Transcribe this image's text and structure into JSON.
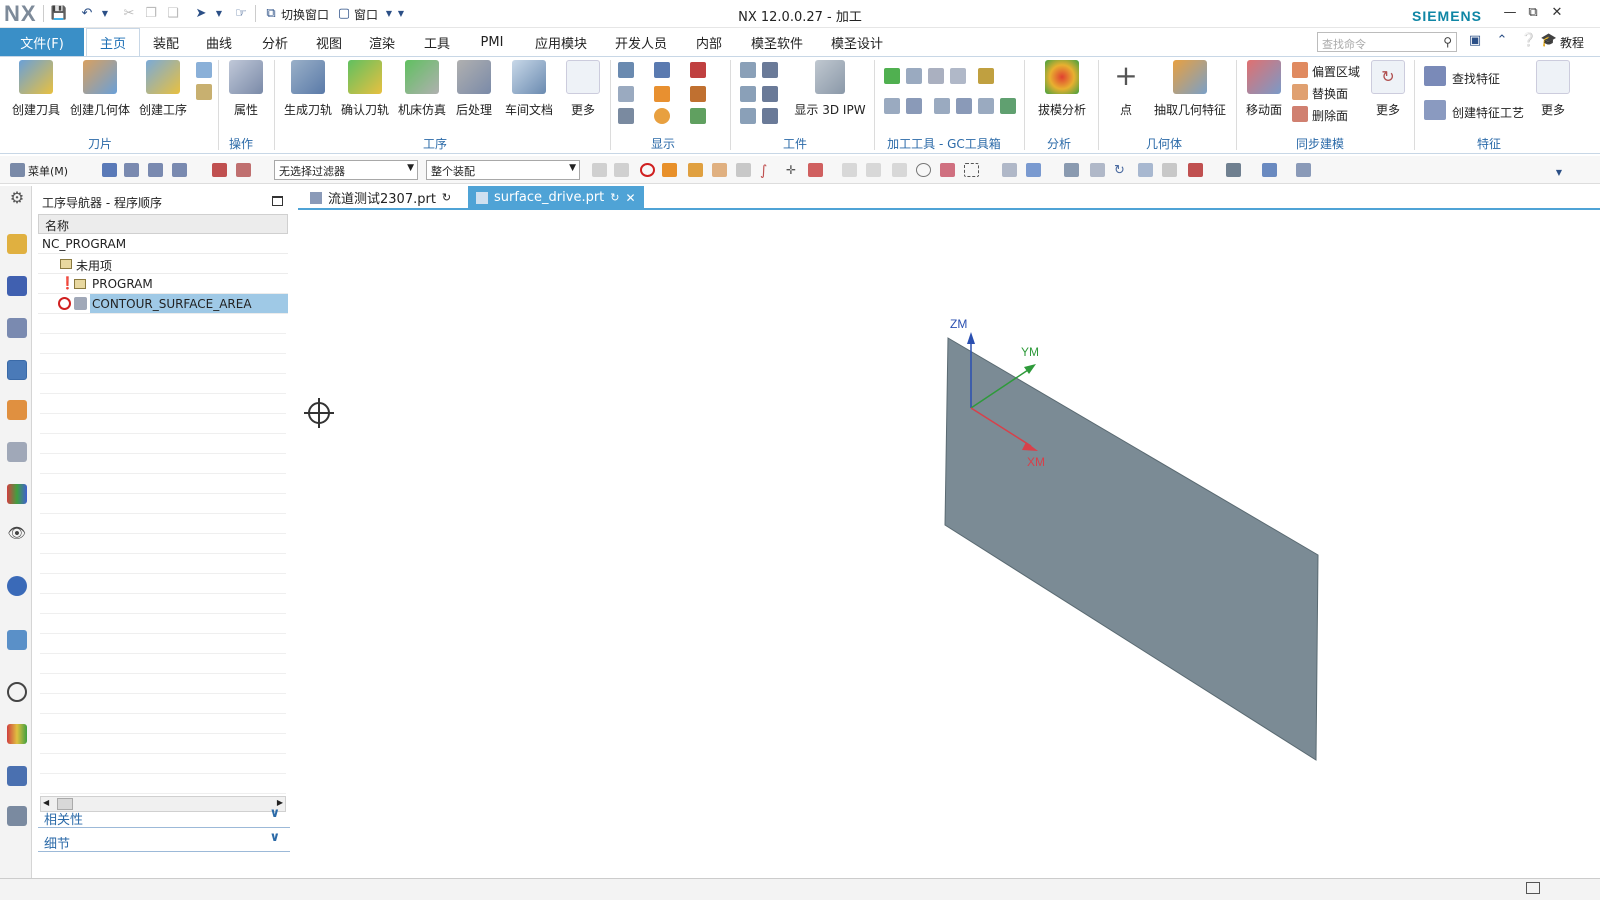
{
  "app": {
    "logo": "NX",
    "window_title": "NX 12.0.0.27 - 加工",
    "brand": "SIEMENS",
    "brand_color": "#0f86a5"
  },
  "quick_access": {
    "switch_window": "切换窗口",
    "window": "窗口"
  },
  "menu": {
    "file": "文件(F)",
    "tabs": [
      "主页",
      "装配",
      "曲线",
      "分析",
      "视图",
      "渲染",
      "工具",
      "PMI",
      "应用模块",
      "开发人员",
      "内部",
      "模圣软件",
      "模圣设计"
    ],
    "active_tab": "主页",
    "search_placeholder": "查找命令",
    "tutorial": "教程"
  },
  "ribbon": {
    "buttons": {
      "create_tool": "创建刀具",
      "create_geometry": "创建几何体",
      "create_operation": "创建工序",
      "properties": "属性",
      "generate_path": "生成刀轨",
      "verify_path": "确认刀轨",
      "machine_sim": "机床仿真",
      "post_process": "后处理",
      "shop_doc": "车间文档",
      "more1": "更多",
      "show_3d_ipw": "显示 3D IPW",
      "draft_analysis": "拔模分析",
      "point": "点",
      "extract_geometry": "抽取几何特征",
      "move_face": "移动面",
      "offset_region": "偏置区域",
      "replace_face": "替换面",
      "delete_face": "删除面",
      "more2": "更多",
      "find_feature": "查找特征",
      "create_feature_process": "创建特征工艺",
      "more3": "更多"
    },
    "groups": {
      "blade": "刀片",
      "operation": "操作",
      "process": "工序",
      "display": "显示",
      "workpiece": "工件",
      "machining_tools": "加工工具 - GC工具箱",
      "analysis": "分析",
      "geometry": "几何体",
      "sync_modeling": "同步建模",
      "feature": "特征"
    }
  },
  "toolbar": {
    "menu_label": "菜单(M)",
    "filter": "无选择过滤器",
    "assembly": "整个装配"
  },
  "navigator": {
    "title": "工序导航器 - 程序顺序",
    "column_header": "名称",
    "items": [
      "NC_PROGRAM",
      "未用项",
      "PROGRAM",
      "CONTOUR_SURFACE_AREA"
    ],
    "selected": "CONTOUR_SURFACE_AREA",
    "panels": [
      "相关性",
      "细节"
    ]
  },
  "doc_tabs": [
    "流道测试2307.prt",
    "surface_drive.prt"
  ],
  "active_doc": "surface_drive.prt",
  "viewport": {
    "axes": {
      "z": "ZM",
      "y": "YM",
      "x": "XM"
    },
    "colors": {
      "z": "#2a4fb0",
      "y": "#2e9a3a",
      "x": "#d8404a",
      "surface": "#7b8b95"
    }
  }
}
